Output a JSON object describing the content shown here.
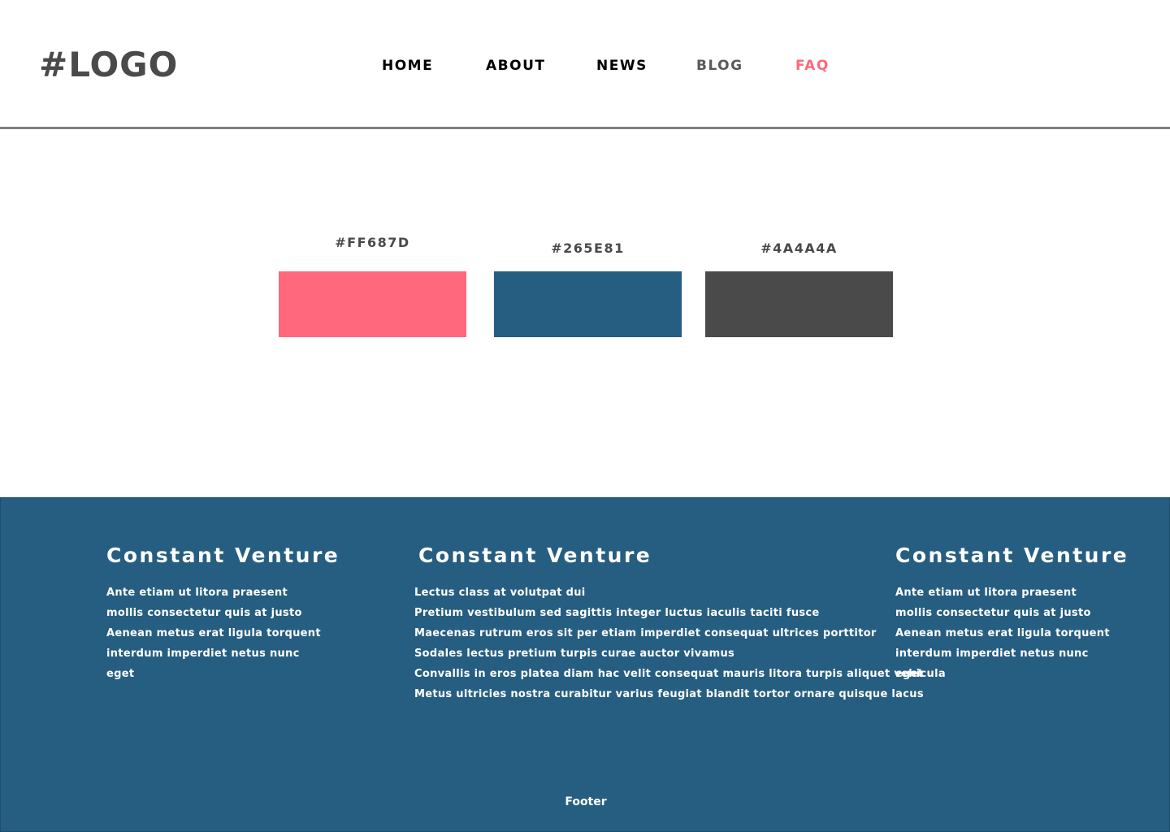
{
  "header": {
    "logo": "#LOGO",
    "nav": [
      {
        "label": "HOME"
      },
      {
        "label": "ABOUT"
      },
      {
        "label": "NEWS"
      },
      {
        "label": "BLOG"
      },
      {
        "label": "FAQ"
      }
    ]
  },
  "palette": [
    {
      "label": "#FF687D",
      "color": "#FF687D"
    },
    {
      "label": "#265E81",
      "color": "#265E81"
    },
    {
      "label": "#4A4A4A",
      "color": "#4A4A4A"
    }
  ],
  "footer": {
    "columns": [
      {
        "title": "Constant Venture",
        "lines": [
          "Ante etiam ut litora praesent",
          "mollis consectetur quis at justo",
          "Aenean metus erat ligula torquent",
          "interdum imperdiet netus nunc",
          "eget"
        ]
      },
      {
        "title": "Constant Venture",
        "lines": [
          "Lectus class at volutpat dui",
          "Pretium vestibulum sed sagittis integer luctus iaculis taciti fusce",
          "Maecenas rutrum eros sit per etiam imperdiet consequat ultrices porttitor",
          "Sodales lectus pretium turpis curae auctor vivamus",
          "Convallis in eros platea diam hac velit consequat mauris litora turpis aliquet vehicula",
          "Metus ultricies nostra curabitur varius feugiat blandit tortor ornare quisque lacus"
        ]
      },
      {
        "title": "Constant Venture",
        "lines": [
          "Ante etiam ut litora praesent",
          "mollis consectetur quis at justo",
          "Aenean metus erat ligula torquent",
          "interdum imperdiet netus nunc",
          "eget"
        ]
      }
    ],
    "footer_text": "Footer"
  },
  "colors": {
    "accent": "#FF687D",
    "brand": "#265E81",
    "text": "#4A4A4A"
  }
}
